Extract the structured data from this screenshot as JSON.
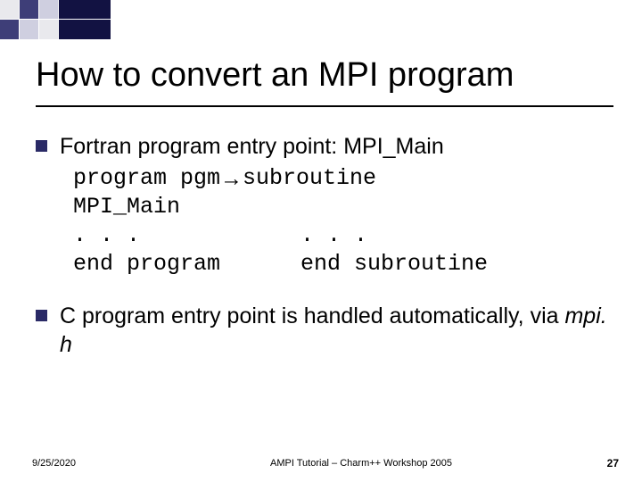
{
  "decor": {},
  "slide": {
    "title": "How to convert an MPI program",
    "bullet1": "Fortran program entry point: MPI_Main",
    "code": {
      "l1a": "program pgm",
      "l1arrow": "  →   ",
      "l1b": "subroutine",
      "l2": " MPI_Main",
      "l3a": ". . .",
      "l3b": ". . .",
      "l4a": "end program",
      "l4b": "end subroutine"
    },
    "bullet2_a": "C program entry point is handled automatically, via ",
    "bullet2_b": "mpi. h"
  },
  "footer": {
    "date": "9/25/2020",
    "center": "AMPI Tutorial – Charm++ Workshop 2005",
    "page": "27"
  }
}
